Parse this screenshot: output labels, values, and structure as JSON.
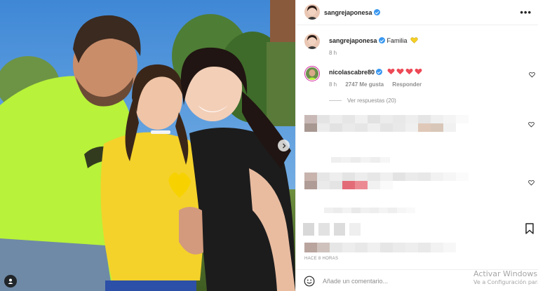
{
  "post": {
    "author": "sangrejaponesa",
    "verified": true,
    "more_icon": "more-horizontal-icon",
    "more_label": "•••"
  },
  "caption": {
    "author": "sangrejaponesa",
    "text": "Familia",
    "emoji": "yellow-heart-emoji",
    "time": "8 h"
  },
  "top_comment": {
    "author": "nicolascabre80",
    "verified": true,
    "emoji_count": 4,
    "emoji": "red-heart-emoji",
    "time": "8 h",
    "likes": "2747 Me gusta",
    "reply_label": "Responder",
    "view_replies": "Ver respuestas (20)"
  },
  "post_time": "HACE 8 HORAS",
  "comment_box": {
    "placeholder": "Añade un comentario...",
    "emoji_icon": "smiley-icon"
  },
  "windows_watermark": {
    "line1": "Activar Windows",
    "line2": "Ve a Configuración para"
  },
  "icons": {
    "next": "chevron-right-icon",
    "tag": "user-tag-icon",
    "like": "heart-outline-icon",
    "bookmark": "bookmark-icon"
  },
  "colors": {
    "verified": "#3897f0",
    "heart_red": "#ed4956",
    "heart_yellow": "#f5d024",
    "muted_text": "#8e8e8e",
    "divider": "#efefef"
  }
}
